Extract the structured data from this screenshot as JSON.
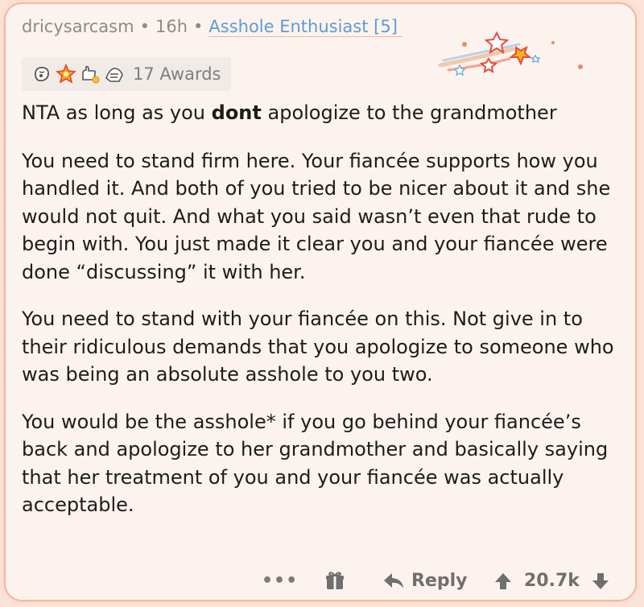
{
  "comment": {
    "username": "dricysarcasm",
    "separator": "•",
    "age": "16h",
    "flair": "Asshole Enthusiast [5]",
    "awards": {
      "count_label": "17 Awards",
      "icons": [
        "hand-award-icon",
        "fireworks-award-icon",
        "wholesome-hands-award-icon",
        "hug-award-icon"
      ]
    },
    "paragraphs": {
      "p1_before": "NTA as long as you ",
      "p1_bold": "dont",
      "p1_after": " apologize to the grandmother",
      "p2": "You need to stand firm here. Your fiancée supports how you handled it. And both of you tried to be nicer about it and she would not quit. And what you said wasn’t even that rude to begin with. You just made it clear you and your fiancée were done “discussing” it with her.",
      "p3": "You need to stand with your fiancée on this. Not give in to their ridiculous demands that you apologize to someone who was being an absolute asshole to you two.",
      "p4": "You would be the asshole* if you go behind your fiancée’s back and apologize to her grandmother and basically saying that her treatment of you and your fiancée was actually acceptable."
    }
  },
  "footer": {
    "more_label": "•••",
    "reply_label": "Reply",
    "score": "20.7k",
    "icons": [
      "gift-icon",
      "reply-arrow-icon",
      "upvote-arrow-icon",
      "downvote-arrow-icon"
    ]
  },
  "colors": {
    "flair": "#5b9bd5",
    "border": "#f3b9a2",
    "card_bg": "#fdf3ee",
    "text": "#1c1c1c",
    "meta": "#8b8b8b"
  }
}
